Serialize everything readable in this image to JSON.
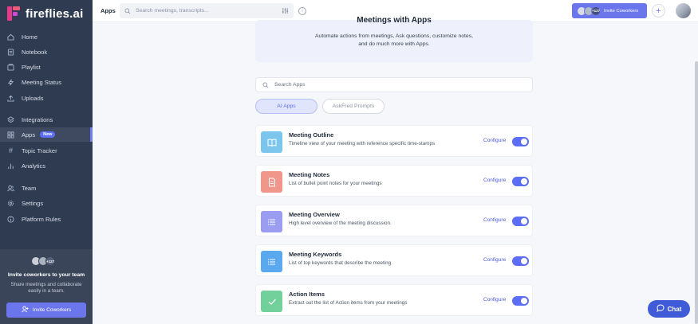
{
  "brand": {
    "name": "fireflies.ai"
  },
  "sidebar": {
    "items": [
      {
        "label": "Home",
        "icon": "home-icon"
      },
      {
        "label": "Notebook",
        "icon": "notebook-icon"
      },
      {
        "label": "Playlist",
        "icon": "playlist-icon"
      },
      {
        "label": "Meeting Status",
        "icon": "lightning-icon"
      },
      {
        "label": "Uploads",
        "icon": "upload-icon"
      },
      {
        "label": "Integrations",
        "icon": "layers-icon"
      },
      {
        "label": "Apps",
        "icon": "grid-icon",
        "badge": "New",
        "active": true
      },
      {
        "label": "Topic Tracker",
        "icon": "hash-icon"
      },
      {
        "label": "Analytics",
        "icon": "bar-chart-icon"
      },
      {
        "label": "Team",
        "icon": "team-icon"
      },
      {
        "label": "Settings",
        "icon": "gear-icon"
      },
      {
        "label": "Platform Rules",
        "icon": "info-icon"
      }
    ],
    "invite": {
      "avatar_count": "+127",
      "title": "Invite coworkers to your team",
      "description": "Share meetings and collaborate easily in a team.",
      "button_label": "Invite Coworkers"
    }
  },
  "topbar": {
    "title": "Apps",
    "search_placeholder": "Search meetings, transcripts...",
    "invite_count": "+127",
    "invite_label": "Invite Coworkers",
    "plus_label": "+"
  },
  "hero": {
    "title": "Meetings with Apps",
    "description": "Automate actions from meetings, Ask questions, customize notes, and do much more with Apps."
  },
  "apps_search": {
    "placeholder": "Search Apps"
  },
  "tabs": [
    {
      "label": "AI Apps",
      "active": true
    },
    {
      "label": "AskFred Prompts",
      "active": false
    }
  ],
  "apps": [
    {
      "name": "Meeting Outline",
      "description": "Timeline view of your meeting with reference specific time-stamps",
      "configure": "Configure",
      "enabled": true,
      "icon": "book-icon",
      "color": "#7cc6ee"
    },
    {
      "name": "Meeting Notes",
      "description": "List of bullet point notes for your meetings",
      "configure": "Configure",
      "enabled": true,
      "icon": "document-icon",
      "color": "#f1968b"
    },
    {
      "name": "Meeting Overview",
      "description": "High level overview of the meeting discussion.",
      "configure": "Configure",
      "enabled": true,
      "icon": "list-icon",
      "color": "#9a9df0"
    },
    {
      "name": "Meeting Keywords",
      "description": "List of top keywords that describe the meeting",
      "configure": "Configure",
      "enabled": true,
      "icon": "list-icon",
      "color": "#5aa9ee"
    },
    {
      "name": "Action Items",
      "description": "Extract out the list of Action items from your meetings",
      "configure": "Configure",
      "enabled": true,
      "icon": "check-icon",
      "color": "#72d19a"
    }
  ],
  "chat": {
    "label": "Chat"
  },
  "colors": {
    "sidebar": "#2f3b51",
    "accent": "#5b6ef5",
    "invite_button": "#6b76ec",
    "chat_button": "#3f5bd8"
  }
}
